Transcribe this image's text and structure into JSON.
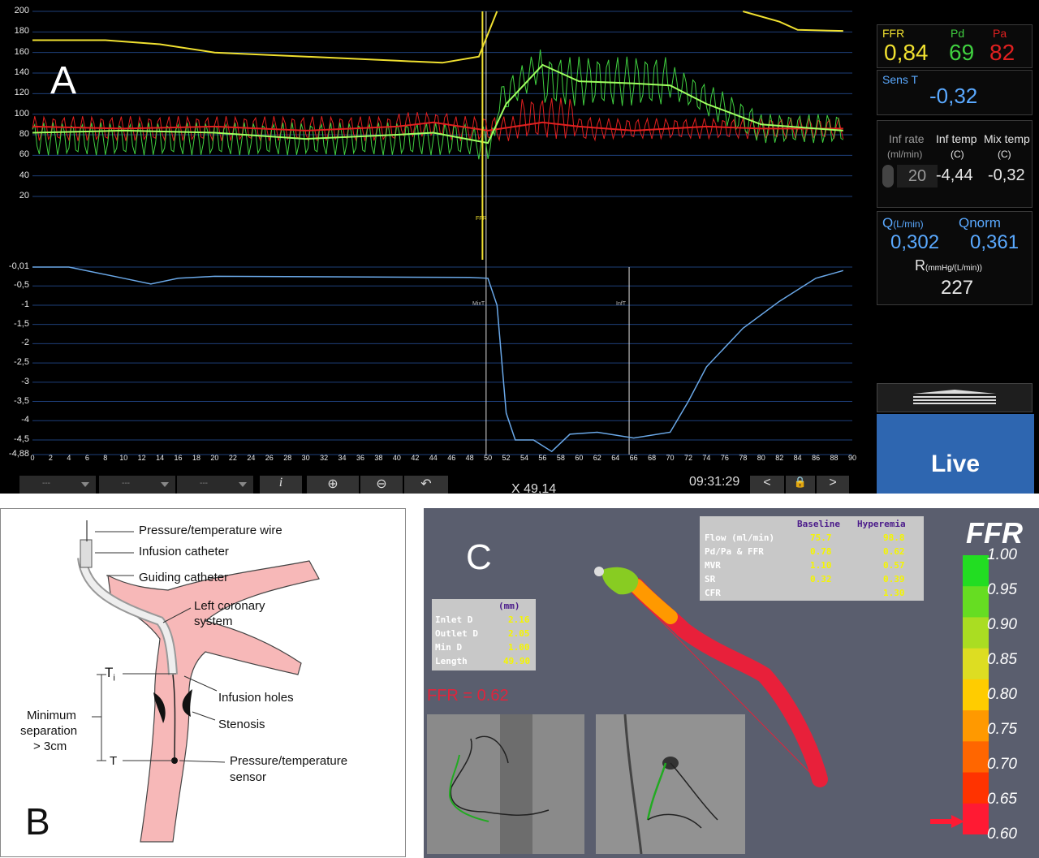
{
  "panel_a": {
    "label": "A",
    "y_ticks_pressure": [
      "200",
      "180",
      "160",
      "140",
      "120",
      "100",
      "80",
      "60",
      "40",
      "20"
    ],
    "y_ticks_temp": [
      "-0,01",
      "-0,5",
      "-1",
      "-1,5",
      "-2",
      "-2,5",
      "-3",
      "-3,5",
      "-4",
      "-4,5",
      "-4,88"
    ],
    "x_ticks": [
      "0",
      "2",
      "4",
      "6",
      "8",
      "10",
      "12",
      "14",
      "16",
      "18",
      "20",
      "22",
      "24",
      "26",
      "28",
      "30",
      "32",
      "34",
      "36",
      "38",
      "40",
      "42",
      "44",
      "46",
      "48",
      "50",
      "52",
      "54",
      "56",
      "58",
      "60",
      "62",
      "64",
      "66",
      "68",
      "70",
      "72",
      "74",
      "76",
      "78",
      "80",
      "82",
      "84",
      "86",
      "88",
      "90"
    ],
    "markers": {
      "ffr": "FFR",
      "mix": "MixT",
      "inf": "InfT"
    },
    "ffr_box": {
      "ffr_label": "FFR",
      "ffr_value": "0,84",
      "pd_label": "Pd",
      "pd_value": "69",
      "pa_label": "Pa",
      "pa_value": "82"
    },
    "sens_box": {
      "label": "Sens T",
      "value": "-0,32"
    },
    "inf_box": {
      "inf_rate_label": "Inf rate",
      "inf_rate_unit": "(ml/min)",
      "inf_rate_value": "20",
      "inf_temp_label": "Inf temp",
      "inf_temp_unit": "(C)",
      "inf_temp_value": "-4,44",
      "mix_temp_label": "Mix temp",
      "mix_temp_unit": "(C)",
      "mix_temp_value": "-0,32"
    },
    "flow_box": {
      "q_label": "Q",
      "q_unit": "(L/min)",
      "q_value": "0,302",
      "qnorm_label": "Qnorm",
      "qnorm_value": "0,361",
      "r_label": "R",
      "r_unit": "(mmHg/(L/min))",
      "r_value": "227"
    },
    "live_label": "Live",
    "toolbar": {
      "dd1": "---",
      "dd2": "---",
      "dd3": "---",
      "info": "i",
      "zoom_in": "⊕",
      "zoom_out": "⊖",
      "undo": "↶",
      "cursor": "X 49,14",
      "time": "09:31:29",
      "prev": "<",
      "lock": "🔒",
      "next": ">"
    },
    "colors": {
      "ffr": "#f0e030",
      "pd": "#40d040",
      "pa": "#e02020",
      "temp": "#6aa8e8",
      "live": "#2e66b0"
    }
  },
  "panel_b": {
    "label": "B",
    "labels": {
      "wire": "Pressure/temperature wire",
      "infusion_catheter": "Infusion catheter",
      "guiding_catheter": "Guiding catheter",
      "left_coronary_1": "Left coronary",
      "left_coronary_2": "system",
      "ti": "T",
      "ti_sub": "i",
      "infusion_holes": "Infusion holes",
      "stenosis": "Stenosis",
      "min_sep_1": "Minimum",
      "min_sep_2": "separation",
      "min_sep_3": "> 3cm",
      "t": "T",
      "sensor_1": "Pressure/temperature",
      "sensor_2": "sensor"
    }
  },
  "panel_c": {
    "label": "C",
    "flow_table": {
      "headers": [
        "",
        "Baseline",
        "Hyperemia"
      ],
      "rows": [
        [
          "Flow (ml/min)",
          "75.7",
          "98.8"
        ],
        [
          "Pd/Pa & FFR",
          "0.78",
          "0.62"
        ],
        [
          "MVR",
          "1.10",
          "0.57"
        ],
        [
          "SR",
          "0.32",
          "0.39"
        ],
        [
          "CFR",
          "",
          "1.30"
        ]
      ]
    },
    "geom_table": {
      "header": "(mm)",
      "rows": [
        [
          "Inlet D",
          "2.16"
        ],
        [
          "Outlet D",
          "2.05"
        ],
        [
          "Min D",
          "1.00"
        ],
        [
          "Length",
          "49.90"
        ]
      ]
    },
    "ffr_result": "FFR = 0.62",
    "scale_title": "FFR",
    "scale_ticks": [
      "1.00",
      "0.95",
      "0.90",
      "0.85",
      "0.80",
      "0.75",
      "0.70",
      "0.65",
      "0.60"
    ],
    "scale_colors": [
      "#22dd22",
      "#66dd22",
      "#aadd22",
      "#dddd22",
      "#ffcc00",
      "#ff9900",
      "#ff6600",
      "#ff3300",
      "#ff1a33"
    ]
  }
}
